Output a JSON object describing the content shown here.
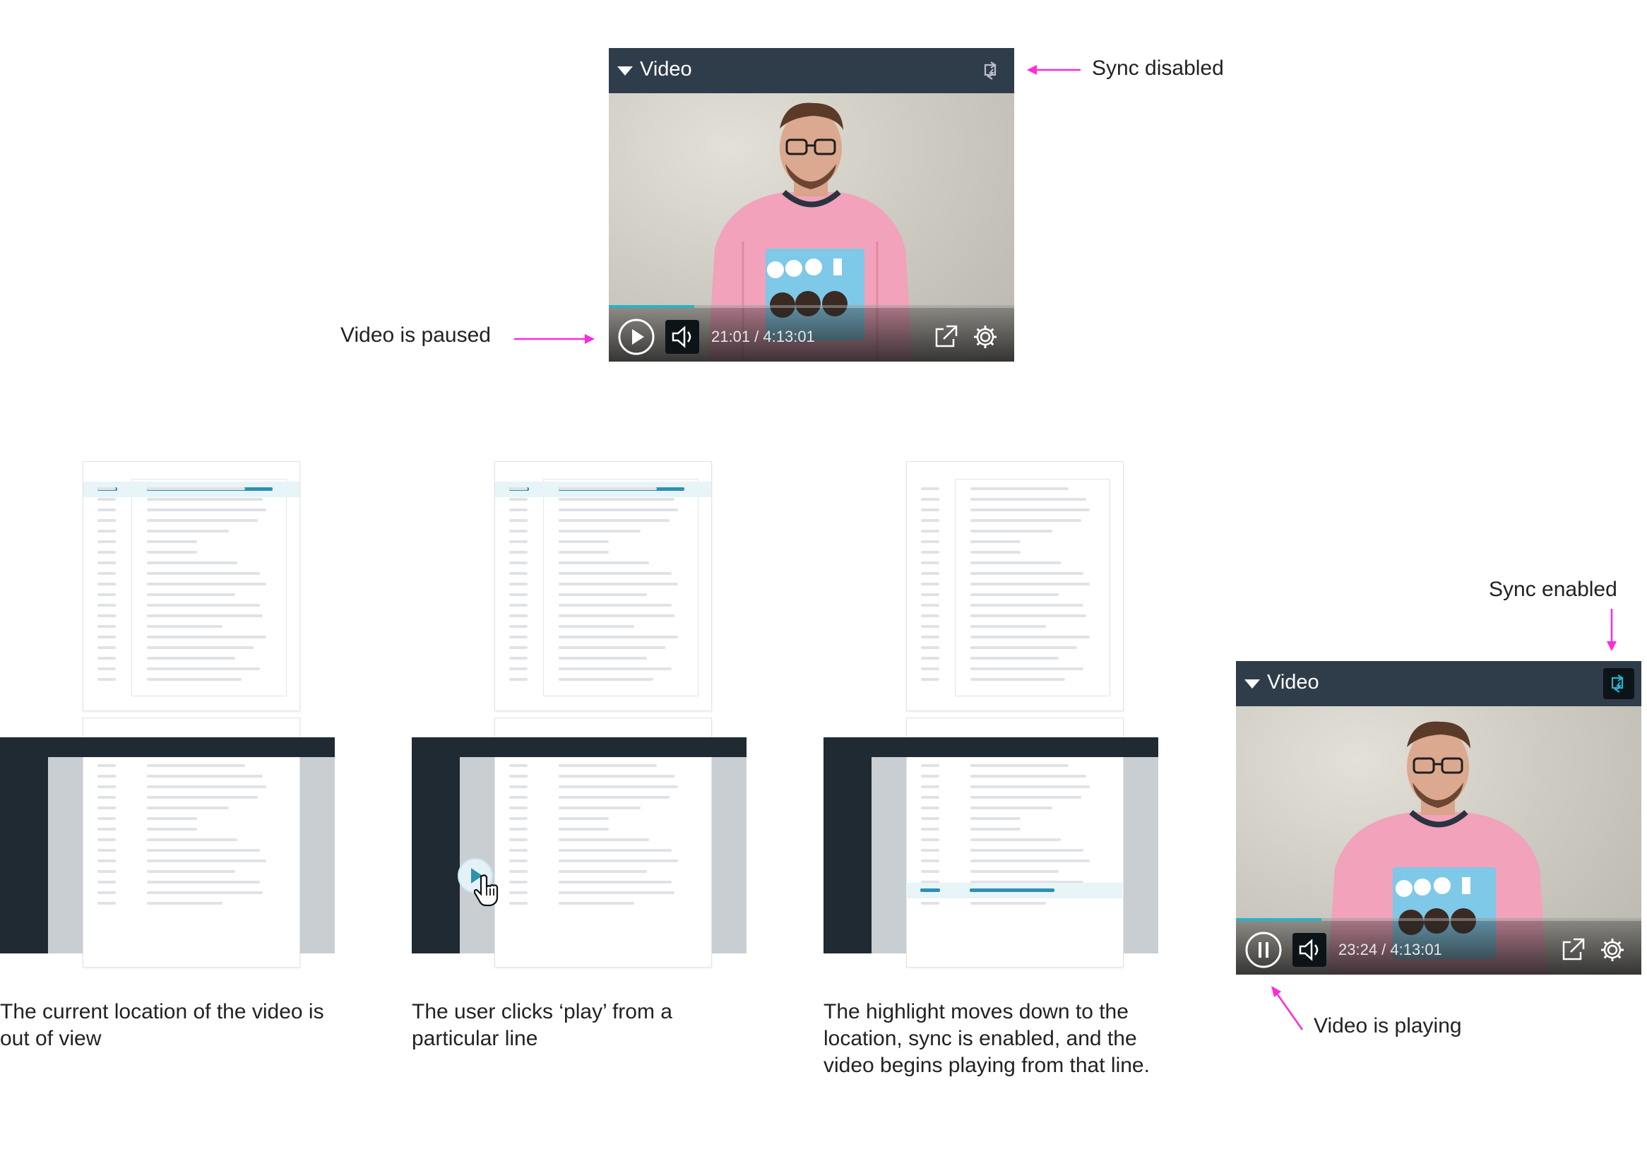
{
  "top_video": {
    "title": "Video",
    "time": "21:01 / 4:13:01",
    "state": "paused",
    "sync": "disabled",
    "progress_fraction": 0.21
  },
  "right_video": {
    "title": "Video",
    "time": "23:24 / 4:13:01",
    "state": "playing",
    "sync": "enabled",
    "progress_fraction": 0.21
  },
  "annotations": {
    "sync_disabled": "Sync disabled",
    "video_paused": "Video is paused",
    "sync_enabled": "Sync enabled",
    "video_playing": "Video is playing"
  },
  "captions": {
    "step1": "The current location of the video is out of view",
    "step2": "The user clicks ‘play’ from a particular line",
    "step3": "The highlight moves down to the location, sync is enabled, and the video begins playing from that line."
  },
  "colors": {
    "arrow": "#ff2ad8",
    "accent": "#2d91b0",
    "header": "#2f3d4b"
  },
  "icons": [
    "collapse-triangle-icon",
    "sync-icon",
    "play-icon",
    "pause-icon",
    "volume-icon",
    "external-link-icon",
    "gear-icon",
    "hand-cursor-icon"
  ]
}
